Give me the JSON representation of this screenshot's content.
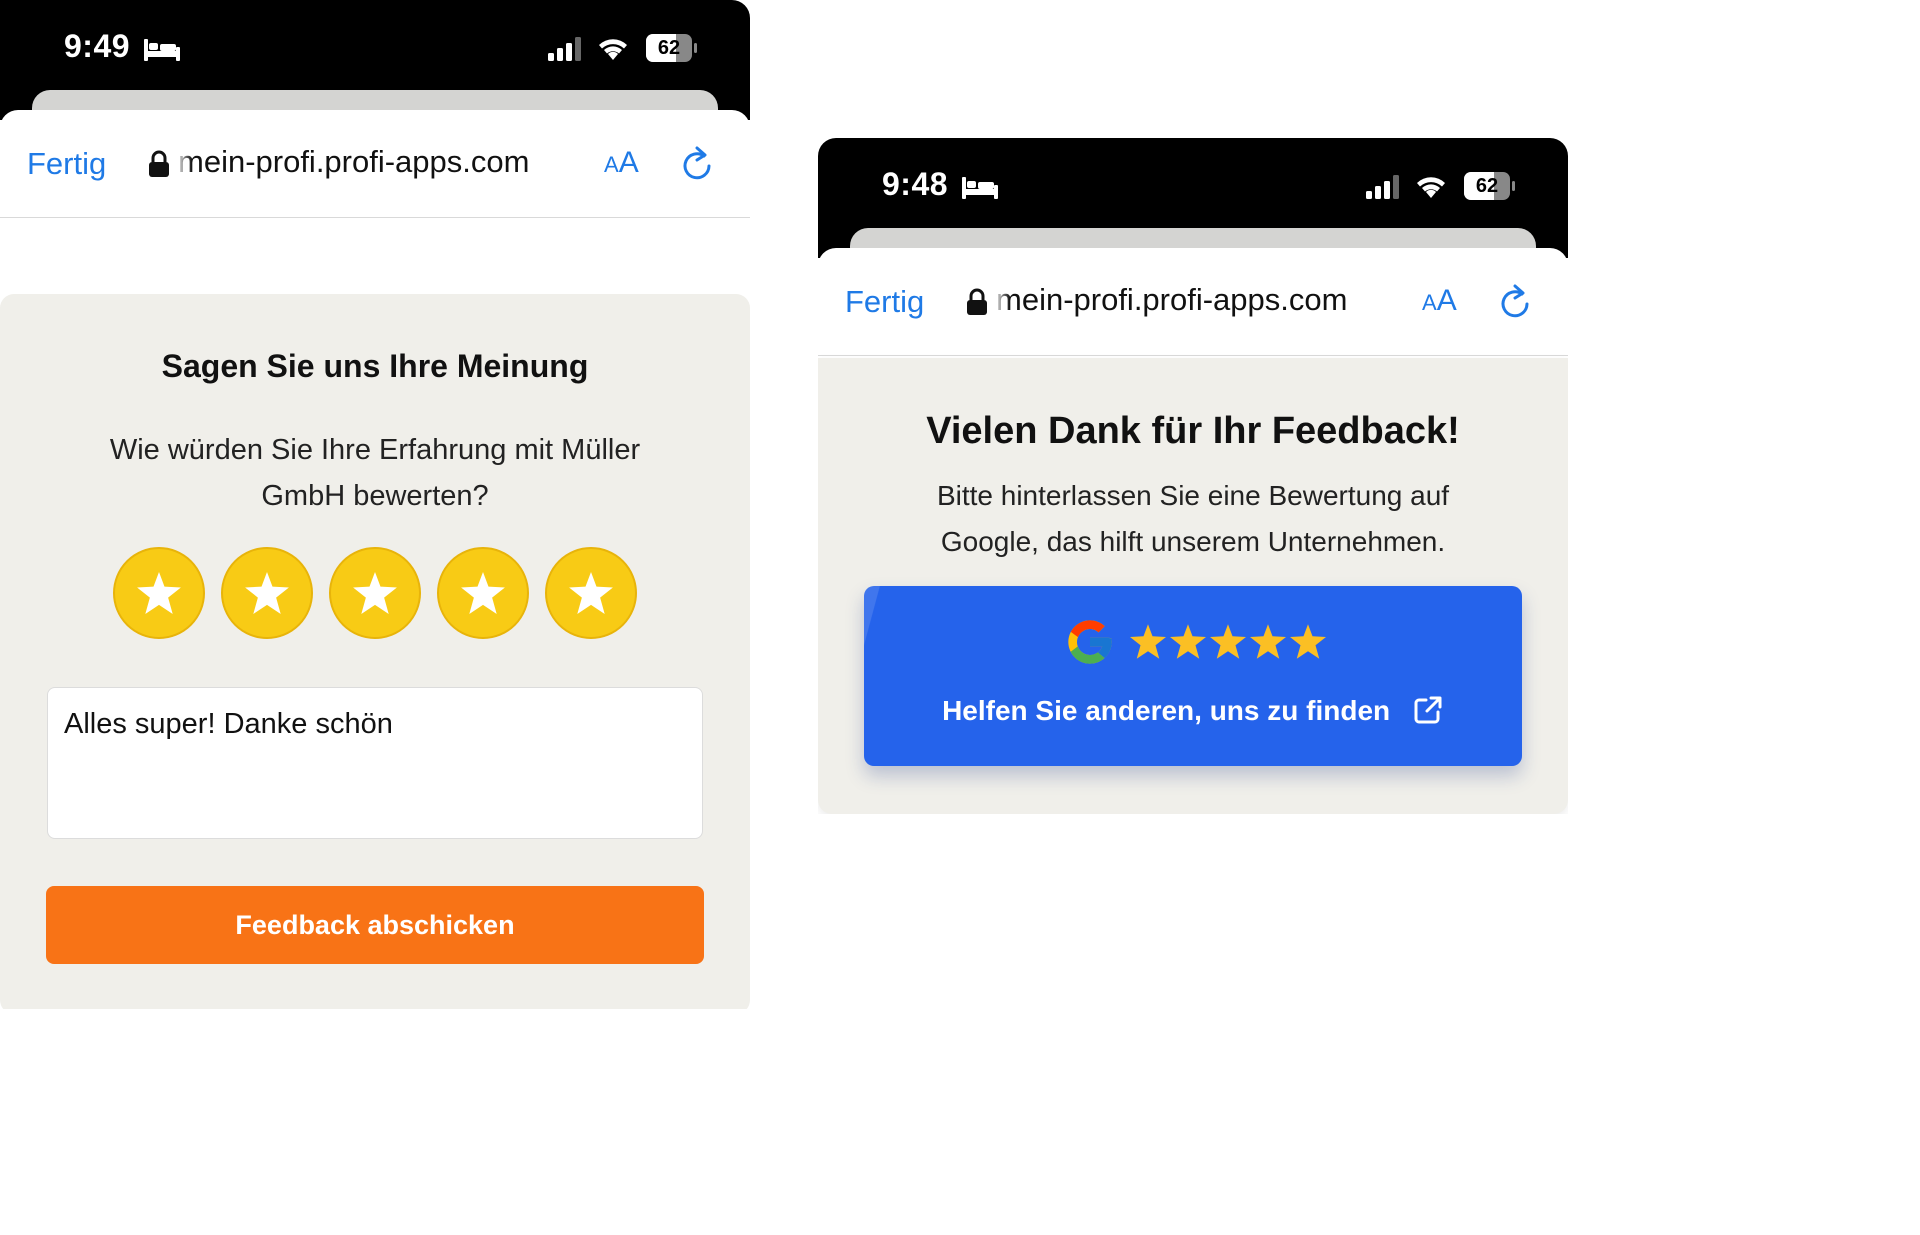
{
  "left_screen": {
    "status_bar": {
      "time": "9:49",
      "battery": "62"
    },
    "browser": {
      "done_label": "Fertig",
      "url": "mein-profi.profi-apps.com",
      "text_size_label": "AA"
    },
    "form": {
      "title": "Sagen Sie uns Ihre Meinung",
      "question": "Wie würden Sie Ihre Erfahrung mit Müller GmbH bewerten?",
      "rating": 5,
      "rating_max": 5,
      "comment_value": "Alles super! Danke schön",
      "submit_label": "Feedback abschicken"
    }
  },
  "right_screen": {
    "status_bar": {
      "time": "9:48",
      "battery": "62"
    },
    "browser": {
      "done_label": "Fertig",
      "url": "mein-profi.profi-apps.com",
      "text_size_label": "AA"
    },
    "thanks": {
      "title": "Vielen Dank für Ihr Feedback!",
      "message": "Bitte hinterlassen Sie eine Bewertung auf Google, das hilft unserem Unternehmen.",
      "google_stars": 5,
      "google_button_label": "Helfen Sie anderen, uns zu finden"
    }
  },
  "colors": {
    "accent_blue": "#1f7ae6",
    "star_yellow": "#f8cb15",
    "submit_orange": "#f87316",
    "google_button_blue": "#2563eb",
    "card_background": "#f0efea"
  },
  "icons": [
    "bed-icon",
    "signal-icon",
    "wifi-icon",
    "battery-icon",
    "lock-icon",
    "reload-icon",
    "star-icon",
    "google-logo-icon",
    "external-link-icon"
  ]
}
